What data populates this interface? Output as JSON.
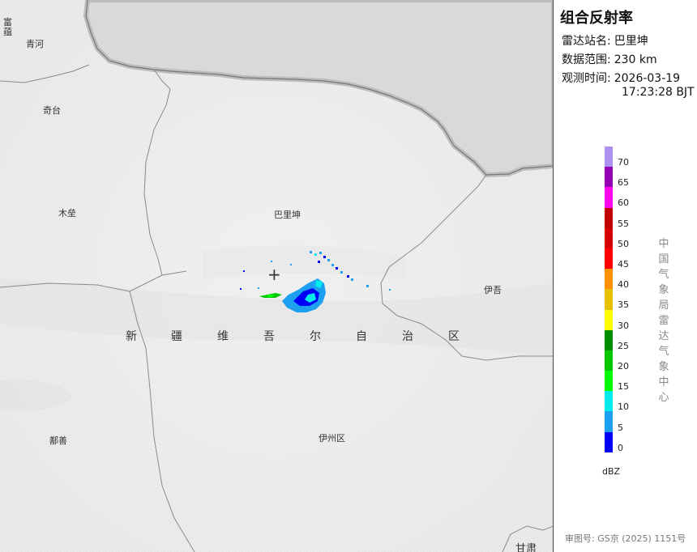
{
  "map": {
    "places": {
      "fuyun": "富\n蕴",
      "qinghe": "青河",
      "qitai": "奇台",
      "mulei": "木垒",
      "balikun": "巴里坤",
      "yiwu": "伊吾",
      "shanshan": "鄯善",
      "yizhouqu": "伊州区",
      "gansu": "甘肃"
    },
    "region_name": [
      "新",
      "疆",
      "维",
      "吾",
      "尔",
      "自",
      "治",
      "区"
    ],
    "station_marker": "+"
  },
  "panel": {
    "title": "组合反射率",
    "station_label": "雷达站名:",
    "station_value": "巴里坤",
    "range_label": "数据范围:",
    "range_value": "230 km",
    "time_label": "观测时间:",
    "time_date": "2026-03-19",
    "time_clock": "17:23:28 BJT",
    "legend": {
      "ticks": [
        "70",
        "65",
        "60",
        "55",
        "50",
        "45",
        "40",
        "35",
        "30",
        "25",
        "20",
        "15",
        "10",
        "5",
        "0"
      ],
      "colors": [
        "#ad90f0",
        "#9600b4",
        "#ff00f0",
        "#c00000",
        "#d60000",
        "#ff0000",
        "#ff9000",
        "#e7c000",
        "#ffff00",
        "#008f00",
        "#00c800",
        "#00ff00",
        "#00ecec",
        "#1ea0f0",
        "#0000f6"
      ],
      "unit": "dBZ"
    },
    "org_vertical": "中国气象局雷达气象中心",
    "review_number": "审图号: GS京 (2025) 1151号"
  }
}
